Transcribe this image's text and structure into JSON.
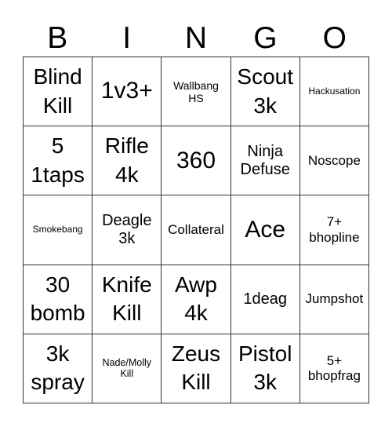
{
  "title_letters": [
    "B",
    "I",
    "N",
    "G",
    "O"
  ],
  "cells": [
    {
      "text": "Blind\nKill",
      "size": "s-l"
    },
    {
      "text": "1v3+",
      "size": "s-xl"
    },
    {
      "text": "Wallbang\nHS",
      "size": "s-xs"
    },
    {
      "text": "Scout\n3k",
      "size": "s-l"
    },
    {
      "text": "Hackusation",
      "size": "s-tiny"
    },
    {
      "text": "5\n1taps",
      "size": "s-l"
    },
    {
      "text": "Rifle\n4k",
      "size": "s-l"
    },
    {
      "text": "360",
      "size": "s-xl"
    },
    {
      "text": "Ninja\nDefuse",
      "size": "s-m"
    },
    {
      "text": "Noscope",
      "size": "s-s"
    },
    {
      "text": "Smokebang",
      "size": "s-tiny"
    },
    {
      "text": "Deagle\n3k",
      "size": "s-m"
    },
    {
      "text": "Collateral",
      "size": "s-s"
    },
    {
      "text": "Ace",
      "size": "s-xl"
    },
    {
      "text": "7+\nbhopline",
      "size": "s-s"
    },
    {
      "text": "30\nbomb",
      "size": "s-l"
    },
    {
      "text": "Knife\nKill",
      "size": "s-l"
    },
    {
      "text": "Awp\n4k",
      "size": "s-l"
    },
    {
      "text": "1deag",
      "size": "s-m"
    },
    {
      "text": "Jumpshot",
      "size": "s-s"
    },
    {
      "text": "3k\nspray",
      "size": "s-l"
    },
    {
      "text": "Nade/Molly\nKill",
      "size": "s-xxs"
    },
    {
      "text": "Zeus\nKill",
      "size": "s-l"
    },
    {
      "text": "Pistol\n3k",
      "size": "s-l"
    },
    {
      "text": "5+\nbhopfrag",
      "size": "s-s"
    }
  ]
}
